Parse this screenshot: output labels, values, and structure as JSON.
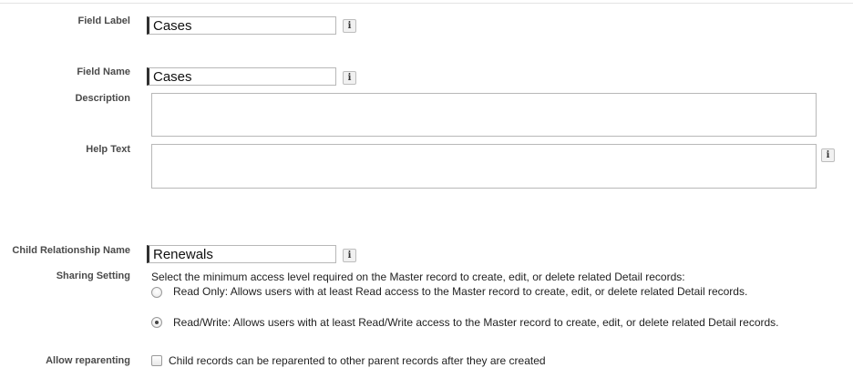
{
  "form": {
    "field_label": {
      "label": "Field Label",
      "value": "Cases"
    },
    "field_name": {
      "label": "Field Name",
      "value": "Cases"
    },
    "description": {
      "label": "Description",
      "value": ""
    },
    "help_text": {
      "label": "Help Text",
      "value": ""
    },
    "child_relationship_name": {
      "label": "Child Relationship Name",
      "value": "Renewals"
    },
    "sharing_setting": {
      "label": "Sharing Setting",
      "instruction": "Select the minimum access level required on the Master record to create, edit, or delete related Detail records:",
      "options": [
        {
          "label": "Read Only: Allows users with at least Read access to the Master record to create, edit, or delete related Detail records.",
          "selected": false
        },
        {
          "label": "Read/Write: Allows users with at least Read/Write access to the Master record to create, edit, or delete related Detail records.",
          "selected": true
        }
      ]
    },
    "allow_reparenting": {
      "label": "Allow reparenting",
      "checkbox_label": "Child records can be reparented to other parent records after they are created",
      "checked": false
    },
    "info_icon_glyph": "i"
  },
  "colors": {
    "required_bar": "#303030",
    "label_text": "#4a4a4a",
    "border": "#b8b8b8"
  }
}
